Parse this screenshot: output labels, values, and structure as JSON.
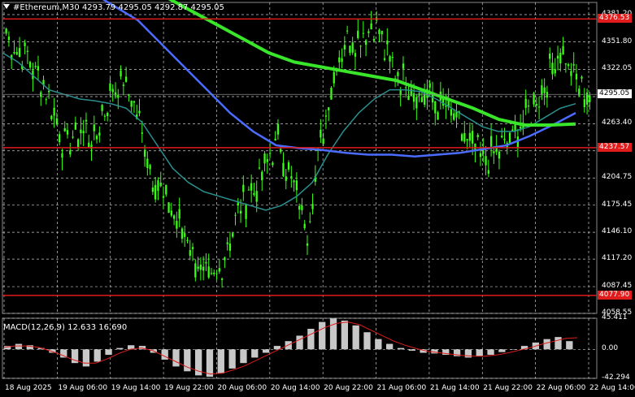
{
  "header": {
    "title": "#Ethereum,M30  4293.79 4295.05 4292.87 4295.05"
  },
  "macd_label": "MACD(12,26,9) 12.633 16.690",
  "price_axis": {
    "ticks": [
      "4381.20",
      "4351.80",
      "4322.05",
      "4292.65",
      "4263.40",
      "4234.10",
      "4204.75",
      "4175.45",
      "4146.10",
      "4117.20",
      "4087.45",
      "4058.55"
    ]
  },
  "macd_axis": {
    "ticks": [
      "45.411",
      "0.00",
      "-42.294"
    ]
  },
  "horizontal_levels": [
    {
      "label": "4376.53",
      "value": 4376.53,
      "color": "#e01c1c"
    },
    {
      "label": "4237.57",
      "value": 4237.57,
      "color": "#e01c1c"
    },
    {
      "label": "4077.90",
      "value": 4077.9,
      "color": "#e01c1c"
    }
  ],
  "current_price": {
    "label": "4295.05",
    "value": 4295.05
  },
  "time_axis": {
    "labels": [
      "18 Aug 2025",
      "19 Aug 06:00",
      "19 Aug 14:00",
      "19 Aug 22:00",
      "20 Aug 06:00",
      "20 Aug 14:00",
      "20 Aug 22:00",
      "21 Aug 06:00",
      "21 Aug 14:00",
      "21 Aug 22:00",
      "22 Aug 06:00",
      "22 Aug 14:00"
    ]
  },
  "colors": {
    "background": "#000000",
    "grid": "#c8c8c8",
    "candles": "#39ff14",
    "ma_fast": "#2a8f8f",
    "ma_mid": "#4a6cff",
    "ma_slow": "#39e62a",
    "macd_hist": "#c8c8c8",
    "macd_signal": "#e01c1c"
  },
  "chart_data": {
    "type": "candlestick",
    "symbol": "#Ethereum",
    "timeframe": "M30",
    "ohlc_last": {
      "open": 4293.79,
      "high": 4295.05,
      "low": 4292.87,
      "close": 4295.05
    },
    "price_series": [
      4360,
      4345,
      4335,
      4320,
      4300,
      4270,
      4240,
      4250,
      4260,
      4245,
      4280,
      4300,
      4310,
      4290,
      4250,
      4210,
      4190,
      4170,
      4150,
      4130,
      4100,
      4090,
      4110,
      4140,
      4170,
      4190,
      4200,
      4230,
      4245,
      4210,
      4180,
      4150,
      4220,
      4280,
      4330,
      4360,
      4350,
      4365,
      4370,
      4340,
      4320,
      4310,
      4300,
      4295,
      4285,
      4280,
      4270,
      4250,
      4235,
      4225,
      4230,
      4240,
      4250,
      4260,
      4280,
      4300,
      4320,
      4345,
      4320,
      4300,
      4295
    ],
    "ma_fast_series": [
      4340,
      4330,
      4315,
      4300,
      4295,
      4290,
      4288,
      4285,
      4280,
      4265,
      4240,
      4215,
      4200,
      4190,
      4185,
      4180,
      4175,
      4170,
      4175,
      4185,
      4200,
      4230,
      4255,
      4275,
      4290,
      4300,
      4300,
      4298,
      4290,
      4280,
      4270,
      4260,
      4255,
      4255,
      4260,
      4270,
      4280,
      4285
    ],
    "ma_mid_series": [
      4405,
      4390,
      4375,
      4350,
      4325,
      4300,
      4275,
      4255,
      4240,
      4237,
      4235,
      4232,
      4230,
      4230,
      4228,
      4230,
      4232,
      4236,
      4240,
      4250,
      4262,
      4275
    ],
    "ma_slow_series": [
      4420,
      4400,
      4385,
      4370,
      4355,
      4340,
      4330,
      4325,
      4320,
      4315,
      4310,
      4300,
      4290,
      4280,
      4268,
      4262,
      4262,
      4263
    ],
    "macd_histogram": [
      5,
      8,
      6,
      2,
      -5,
      -12,
      -20,
      -25,
      -18,
      -8,
      2,
      6,
      5,
      -5,
      -15,
      -25,
      -32,
      -38,
      -40,
      -35,
      -28,
      -20,
      -12,
      -5,
      5,
      12,
      20,
      30,
      40,
      45,
      42,
      35,
      25,
      15,
      8,
      2,
      -2,
      -5,
      -6,
      -8,
      -10,
      -12,
      -10,
      -8,
      -4,
      0,
      5,
      10,
      15,
      18,
      12
    ],
    "macd_signal": [
      3,
      5,
      5,
      3,
      -2,
      -8,
      -15,
      -20,
      -20,
      -14,
      -6,
      0,
      2,
      -2,
      -10,
      -18,
      -26,
      -32,
      -36,
      -35,
      -30,
      -24,
      -16,
      -8,
      0,
      8,
      16,
      24,
      32,
      38,
      40,
      36,
      28,
      20,
      12,
      6,
      1,
      -3,
      -5,
      -7,
      -9,
      -10,
      -10,
      -8,
      -5,
      -1,
      3,
      8,
      12,
      16,
      17
    ],
    "ylim": [
      4058.55,
      4381.2
    ],
    "macd_ylim": [
      -42.294,
      45.411
    ]
  }
}
